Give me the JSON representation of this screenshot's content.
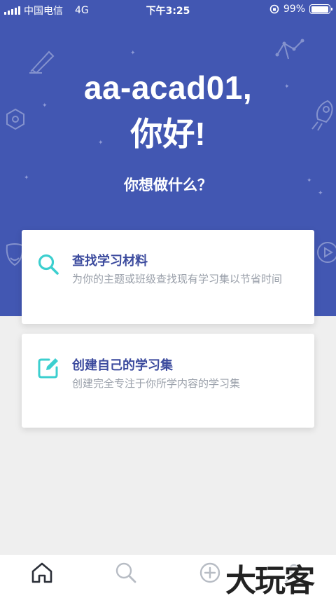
{
  "status_bar": {
    "carrier": "中国电信",
    "network": "4G",
    "time": "下午3:25",
    "battery": "99%",
    "battery_level": 0.99
  },
  "greeting": {
    "username": "aa-acad01,",
    "hello": "你好!",
    "question": "你想做什么？"
  },
  "actions": [
    {
      "icon": "search-icon",
      "title": "查找学习材料",
      "description": "为你的主题或班级查找现有学习集以节省时间"
    },
    {
      "icon": "edit-icon",
      "title": "创建自己的学习集",
      "description": "创建完全专注于你所学内容的学习集"
    }
  ],
  "tabs": [
    {
      "name": "home",
      "icon": "home-icon",
      "active": true
    },
    {
      "name": "search",
      "icon": "search-icon",
      "active": false
    },
    {
      "name": "create",
      "icon": "add-circle-icon",
      "active": false
    },
    {
      "name": "profile",
      "icon": "profile-icon",
      "active": false
    }
  ],
  "watermark": "大玩客",
  "colors": {
    "hero": "#4257b2",
    "card_title": "#3c4b9e",
    "accent_teal": "#3ccfcf",
    "card_desc": "#9aa0aa",
    "background": "#efefef"
  }
}
